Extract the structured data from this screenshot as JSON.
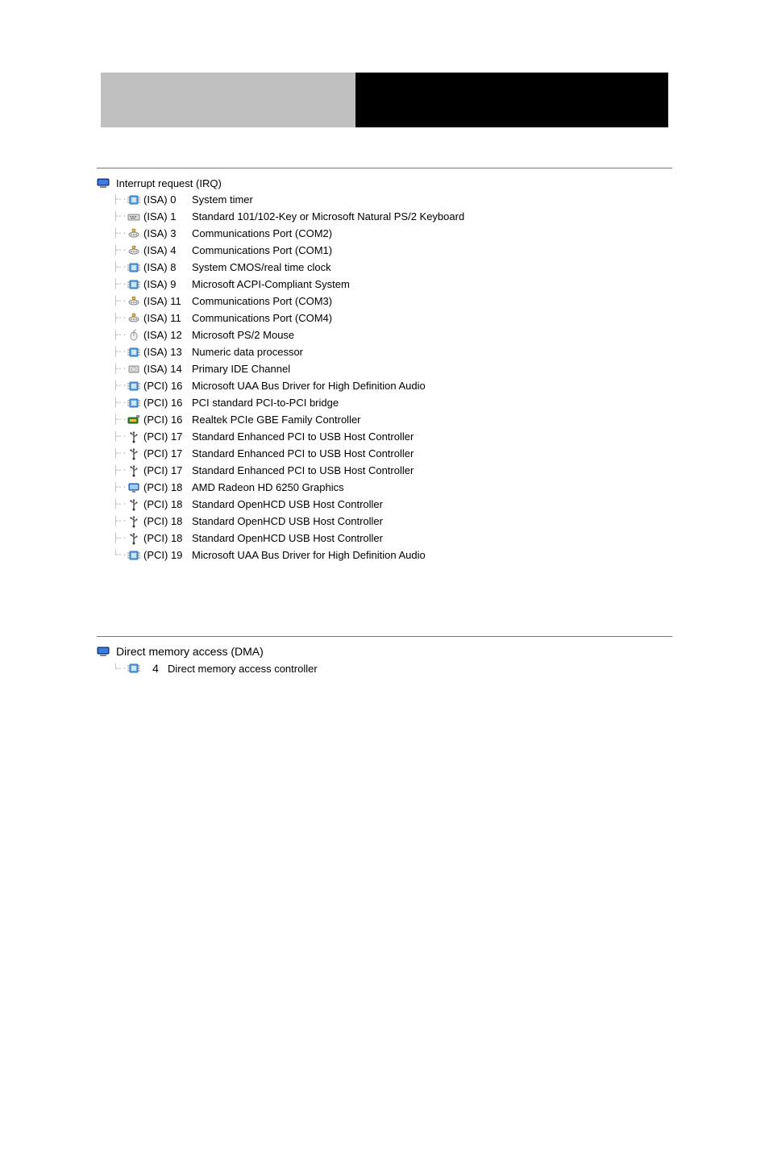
{
  "irq": {
    "title": "Interrupt request (IRQ)",
    "items": [
      {
        "icon": "chip",
        "bus": "(ISA)  0",
        "desc": "System timer"
      },
      {
        "icon": "keyboard",
        "bus": "(ISA)  1",
        "desc": "Standard 101/102-Key or Microsoft Natural PS/2 Keyboard"
      },
      {
        "icon": "port",
        "bus": "(ISA)  3",
        "desc": "Communications Port (COM2)"
      },
      {
        "icon": "port",
        "bus": "(ISA)  4",
        "desc": "Communications Port (COM1)"
      },
      {
        "icon": "chip",
        "bus": "(ISA)  8",
        "desc": "System CMOS/real time clock"
      },
      {
        "icon": "chip",
        "bus": "(ISA)  9",
        "desc": "Microsoft ACPI-Compliant System"
      },
      {
        "icon": "port",
        "bus": "(ISA) 11",
        "desc": "Communications Port (COM3)"
      },
      {
        "icon": "port",
        "bus": "(ISA) 11",
        "desc": "Communications Port (COM4)"
      },
      {
        "icon": "mouse",
        "bus": "(ISA) 12",
        "desc": "Microsoft PS/2 Mouse"
      },
      {
        "icon": "chip",
        "bus": "(ISA) 13",
        "desc": "Numeric data processor"
      },
      {
        "icon": "disk",
        "bus": "(ISA) 14",
        "desc": "Primary IDE Channel"
      },
      {
        "icon": "chip",
        "bus": "(PCI) 16",
        "desc": "Microsoft UAA Bus Driver for High Definition Audio"
      },
      {
        "icon": "chip",
        "bus": "(PCI) 16",
        "desc": "PCI standard PCI-to-PCI bridge"
      },
      {
        "icon": "network",
        "bus": "(PCI) 16",
        "desc": "Realtek PCIe GBE Family Controller"
      },
      {
        "icon": "usb",
        "bus": "(PCI) 17",
        "desc": "Standard Enhanced PCI to USB Host Controller"
      },
      {
        "icon": "usb",
        "bus": "(PCI) 17",
        "desc": "Standard Enhanced PCI to USB Host Controller"
      },
      {
        "icon": "usb",
        "bus": "(PCI) 17",
        "desc": "Standard Enhanced PCI to USB Host Controller"
      },
      {
        "icon": "display",
        "bus": "(PCI) 18",
        "desc": "AMD Radeon HD 6250 Graphics"
      },
      {
        "icon": "usb",
        "bus": "(PCI) 18",
        "desc": "Standard OpenHCD USB Host Controller"
      },
      {
        "icon": "usb",
        "bus": "(PCI) 18",
        "desc": "Standard OpenHCD USB Host Controller"
      },
      {
        "icon": "usb",
        "bus": "(PCI) 18",
        "desc": "Standard OpenHCD USB Host Controller"
      },
      {
        "icon": "chip",
        "bus": "(PCI) 19",
        "desc": "Microsoft UAA Bus Driver for High Definition Audio"
      }
    ]
  },
  "dma": {
    "title": "Direct memory access (DMA)",
    "items": [
      {
        "icon": "chip",
        "num": "4",
        "desc": "Direct memory access controller"
      }
    ]
  }
}
